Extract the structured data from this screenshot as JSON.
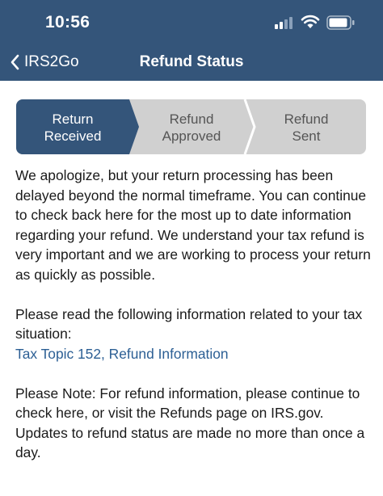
{
  "status_bar": {
    "time": "10:56"
  },
  "nav": {
    "back_label": "IRS2Go",
    "title": "Refund Status"
  },
  "steps": [
    {
      "line1": "Return",
      "line2": "Received",
      "state": "active"
    },
    {
      "line1": "Refund",
      "line2": "Approved",
      "state": "inactive"
    },
    {
      "line1": "Refund",
      "line2": "Sent",
      "state": "inactive"
    }
  ],
  "colors": {
    "header": "#34557a",
    "active_step": "#34557a",
    "inactive_step": "#d0d0d0",
    "link": "#2c5f94"
  },
  "icons": [
    "back-chevron-icon",
    "cellular-signal-icon",
    "wifi-icon",
    "battery-icon"
  ],
  "content": {
    "paragraph1": "We apologize, but your return processing has been delayed beyond the normal timeframe. You can continue to check back here for the most up to date information regarding your refund. We understand your tax refund is very important and we are working to process your return as quickly as possible.",
    "paragraph2": "Please read the following information related to your tax situation:",
    "link": "Tax Topic 152, Refund Information",
    "paragraph3": "Please Note: For refund information, please continue to check here, or visit the Refunds page on IRS.gov. Updates to refund status are made no more than once a day."
  }
}
